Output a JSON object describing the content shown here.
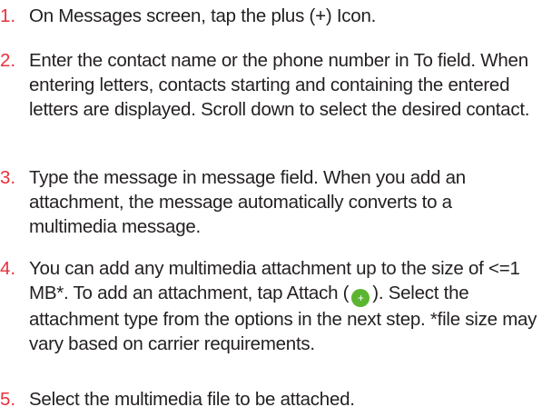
{
  "steps": [
    {
      "number": "1.",
      "text": "On Messages screen, tap the plus (+) Icon."
    },
    {
      "number": "2.",
      "text": "Enter the contact name or the phone number in To field. When entering letters, contacts starting and containing the entered letters are displayed. Scroll down to select the desired contact."
    },
    {
      "number": "3.",
      "text": "Type the message in message field. When you add an attachment, the message automatically converts to a multimedia message."
    },
    {
      "number": "4.",
      "text_before": "You can add any multimedia attachment up to the size of <=1 MB*. To add an attachment, tap Attach (",
      "icon_glyph": "+",
      "icon_name": "attach-plus-icon",
      "text_after": "). Select the attachment type from the options in the next step. *file size may vary based on carrier requirements."
    },
    {
      "number": "5.",
      "text": "Select the multimedia file to be attached."
    }
  ],
  "colors": {
    "step_number": "#e8323c",
    "body_text": "#231f20",
    "attach_icon": "#5bb531"
  }
}
